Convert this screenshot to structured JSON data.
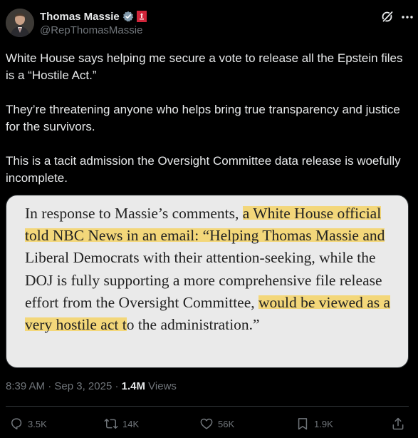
{
  "author": {
    "display_name": "Thomas Massie",
    "handle": "@RepThomasMassie"
  },
  "post": {
    "paragraphs": [
      "White House says helping me secure a vote to release all the Epstein files is a “Hostile Act.”",
      "They’re threatening anyone who helps bring true transparency and justice for the survivors.",
      "This is a tacit admission the Oversight Committee data release is woefully incomplete."
    ]
  },
  "media": {
    "quote_segments": [
      {
        "text": "In response to Massie’s comments, ",
        "highlight": false
      },
      {
        "text": "a White House official told NBC News in an email: “Helping Thomas Massie and",
        "highlight": true
      },
      {
        "text": " Liberal Democrats with their attention-seeking, while the DOJ is fully supporting a more comprehensive file release effort from the Oversight Committee, ",
        "highlight": false
      },
      {
        "text": "would be viewed as a very hostile act t",
        "highlight": true
      },
      {
        "text": "o the administration.”",
        "highlight": false
      }
    ],
    "highlight_color": "#f3d77a"
  },
  "meta": {
    "time": "8:39 AM",
    "separator": " · ",
    "date": "Sep 3, 2025",
    "views_count": "1.4M",
    "views_label": " Views"
  },
  "actions": {
    "replies": "3.5K",
    "reposts": "14K",
    "likes": "56K",
    "bookmarks": "1.9K"
  },
  "icons": {
    "verified": "verified-badge-icon",
    "affiliation": "house-seal-icon",
    "grok": "grok-icon",
    "more": "more-icon",
    "reply": "reply-icon",
    "repost": "repost-icon",
    "like": "heart-icon",
    "bookmark": "bookmark-icon",
    "share": "share-icon"
  },
  "colors": {
    "background": "#000000",
    "text": "#e7e9ea",
    "muted": "#71767b",
    "verified": "#829aab",
    "affiliation": "#d1253a"
  }
}
